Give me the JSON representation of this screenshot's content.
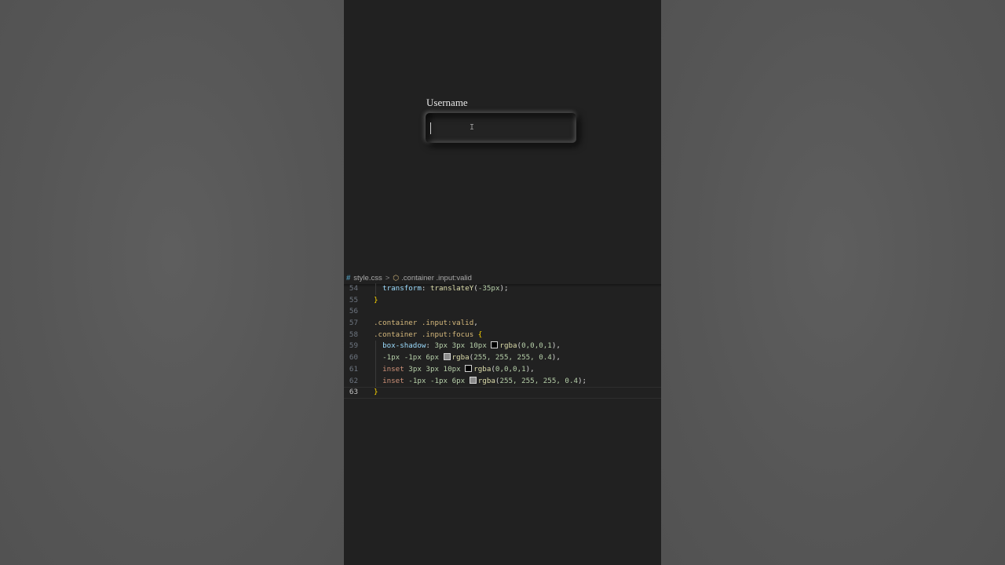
{
  "preview": {
    "label": "Username",
    "input_value": "",
    "cursor_glyph": "I"
  },
  "editor": {
    "breadcrumb": {
      "file": "style.css",
      "separator": ">",
      "symbol": ".container .input:valid"
    },
    "lines": [
      {
        "num": "54",
        "guide": true,
        "tokens": [
          {
            "t": "  ",
            "c": "plain"
          },
          {
            "t": "transform",
            "c": "prop"
          },
          {
            "t": ": ",
            "c": "punc"
          },
          {
            "t": "translateY",
            "c": "fn"
          },
          {
            "t": "(",
            "c": "punc"
          },
          {
            "t": "-35px",
            "c": "num"
          },
          {
            "t": ");",
            "c": "punc"
          }
        ]
      },
      {
        "num": "55",
        "tokens": [
          {
            "t": "}",
            "c": "brace"
          }
        ]
      },
      {
        "num": "56",
        "tokens": []
      },
      {
        "num": "57",
        "tokens": [
          {
            "t": ".container .input:valid",
            "c": "sel"
          },
          {
            "t": ",",
            "c": "punc"
          }
        ]
      },
      {
        "num": "58",
        "tokens": [
          {
            "t": ".container .input:focus",
            "c": "sel"
          },
          {
            "t": " ",
            "c": "plain"
          },
          {
            "t": "{",
            "c": "brace"
          }
        ]
      },
      {
        "num": "59",
        "guide": true,
        "tokens": [
          {
            "t": "  ",
            "c": "plain"
          },
          {
            "t": "box-shadow",
            "c": "prop"
          },
          {
            "t": ": ",
            "c": "punc"
          },
          {
            "t": "3px 3px 10px ",
            "c": "num"
          },
          {
            "swatch": "#000000"
          },
          {
            "t": "rgba",
            "c": "fn"
          },
          {
            "t": "(",
            "c": "punc"
          },
          {
            "t": "0,0,0,1",
            "c": "num"
          },
          {
            "t": "),",
            "c": "punc"
          }
        ]
      },
      {
        "num": "60",
        "guide": true,
        "tokens": [
          {
            "t": "  ",
            "c": "plain"
          },
          {
            "t": "-1px -1px 6px ",
            "c": "num"
          },
          {
            "swatch": "#8c8c8c"
          },
          {
            "t": "rgba",
            "c": "fn"
          },
          {
            "t": "(",
            "c": "punc"
          },
          {
            "t": "255, 255, 255, 0.4",
            "c": "num"
          },
          {
            "t": "),",
            "c": "punc"
          }
        ]
      },
      {
        "num": "61",
        "guide": true,
        "tokens": [
          {
            "t": "  ",
            "c": "plain"
          },
          {
            "t": "inset",
            "c": "kw"
          },
          {
            "t": " ",
            "c": "plain"
          },
          {
            "t": "3px 3px 10px ",
            "c": "num"
          },
          {
            "swatch": "#000000"
          },
          {
            "t": "rgba",
            "c": "fn"
          },
          {
            "t": "(",
            "c": "punc"
          },
          {
            "t": "0,0,0,1",
            "c": "num"
          },
          {
            "t": "),",
            "c": "punc"
          }
        ]
      },
      {
        "num": "62",
        "guide": true,
        "tokens": [
          {
            "t": "  ",
            "c": "plain"
          },
          {
            "t": "inset",
            "c": "kw"
          },
          {
            "t": " ",
            "c": "plain"
          },
          {
            "t": "-1px -1px 6px ",
            "c": "num"
          },
          {
            "swatch": "#8c8c8c"
          },
          {
            "t": "rgba",
            "c": "fn"
          },
          {
            "t": "(",
            "c": "punc"
          },
          {
            "t": "255, 255, 255, 0.4",
            "c": "num"
          },
          {
            "t": ");",
            "c": "punc"
          }
        ]
      },
      {
        "num": "63",
        "current": true,
        "tokens": [
          {
            "t": "}",
            "c": "brace"
          }
        ]
      }
    ]
  },
  "colors": {
    "page_bg": "#212121",
    "outer_bg": "#5a5a5a",
    "property": "#9cdcfe",
    "function": "#dcdcaa",
    "number": "#b5cea8",
    "selector": "#d7ba7d",
    "brace": "#ffd700"
  }
}
